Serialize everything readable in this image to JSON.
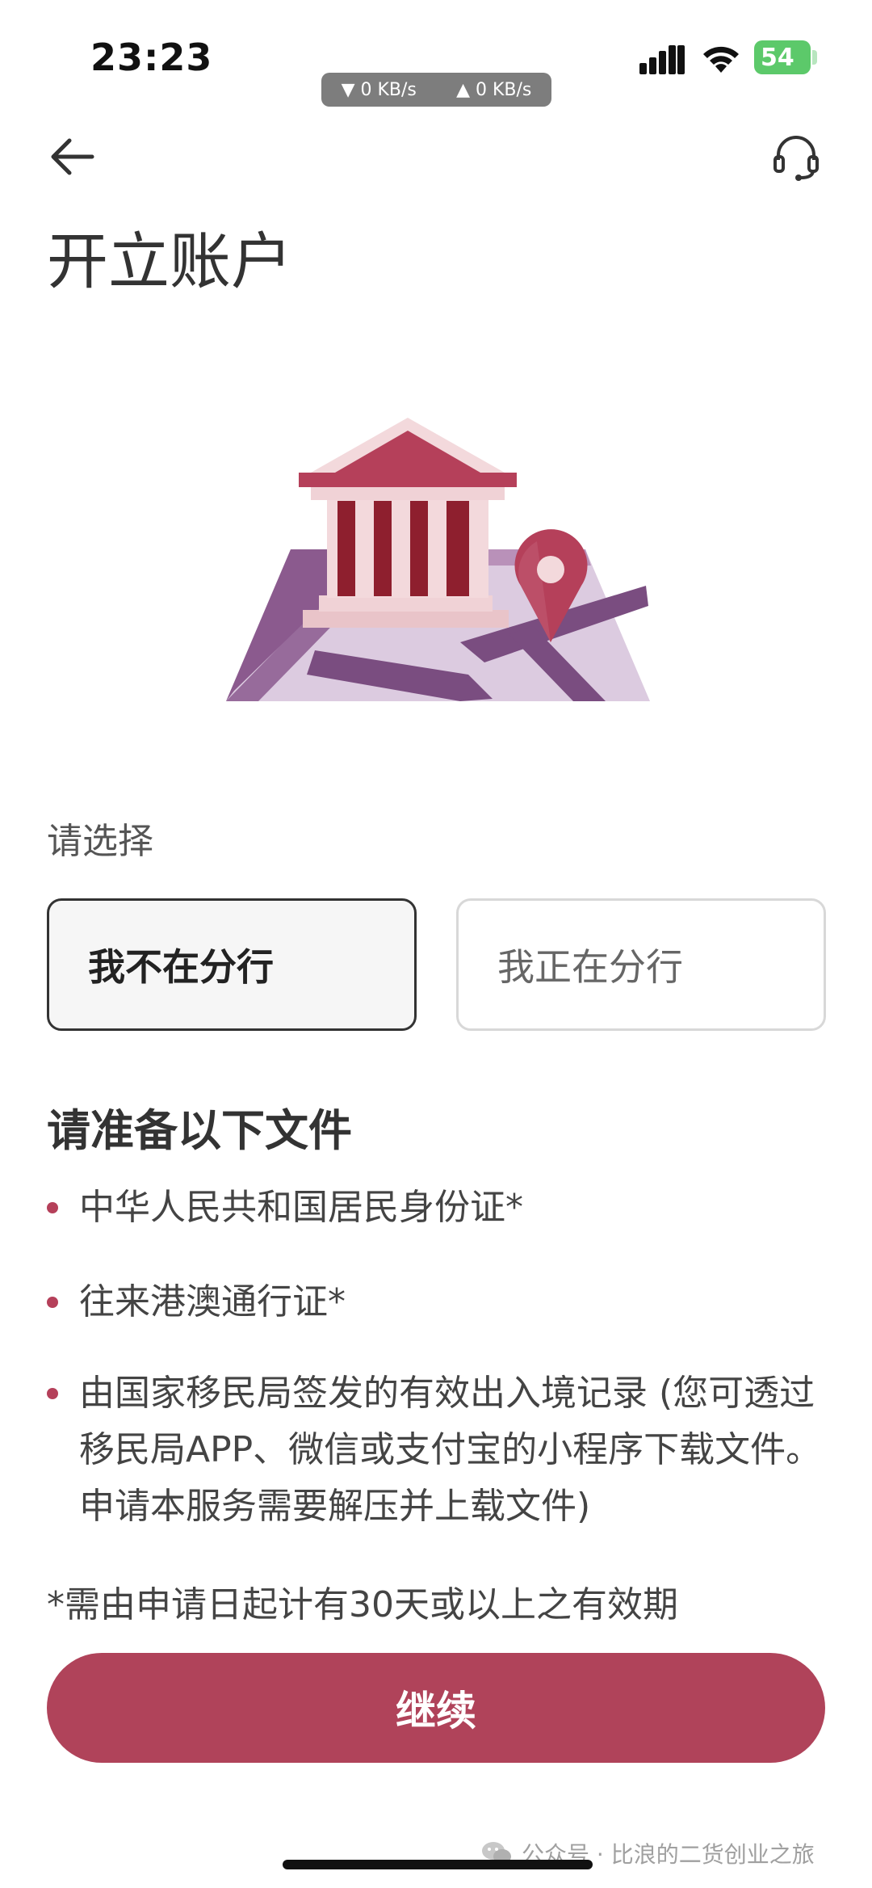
{
  "status_bar": {
    "time": "23:23",
    "battery": "54",
    "net_down": "▼ 0 KB/s",
    "net_up": "▲ 0 KB/s",
    "icons": [
      "signal-icon",
      "wifi-icon",
      "battery-icon"
    ]
  },
  "nav": {
    "back_icon": "arrow-left-icon",
    "support_icon": "headset-icon"
  },
  "page": {
    "title": "开立账户",
    "illustration": "bank-map-pin-illustration"
  },
  "selection": {
    "label": "请选择",
    "options": [
      {
        "label": "我不在分行",
        "selected": true
      },
      {
        "label": "我正在分行",
        "selected": false
      }
    ]
  },
  "documents": {
    "title": "请准备以下文件",
    "items": [
      "中华人民共和国居民身份证*",
      "往来港澳通行证*",
      "由国家移民局签发的有效出入境记录 (您可透过移民局APP、微信或支付宝的小程序下载文件。申请本服务需要解压并上载文件)"
    ],
    "footnote": "*需由申请日起计有30天或以上之有效期"
  },
  "actions": {
    "continue_label": "继续"
  },
  "watermark": {
    "text": "公众号 · 比浪的二货创业之旅",
    "icon": "wechat-icon"
  },
  "colors": {
    "accent": "#b0435a",
    "bullet": "#b5405a",
    "battery": "#5cc96a"
  }
}
